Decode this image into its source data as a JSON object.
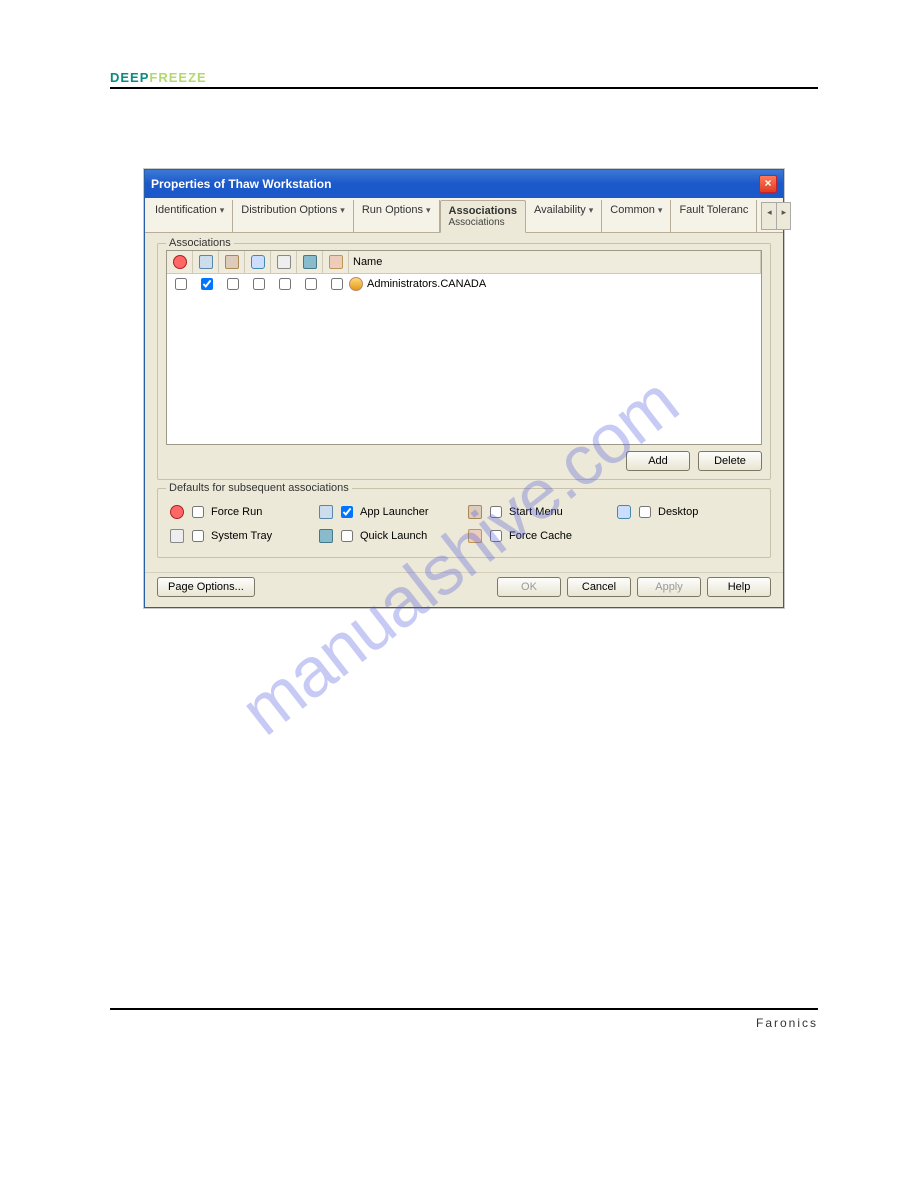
{
  "page": {
    "logo_part1": "DEEP",
    "logo_part2": "FREEZE",
    "watermark": "manualshive.com",
    "footer_brand": "Faronics"
  },
  "dialog": {
    "title": "Properties of Thaw Workstation",
    "tabs": [
      {
        "label": "Identification"
      },
      {
        "label": "Distribution Options"
      },
      {
        "label": "Run Options"
      },
      {
        "label": "Associations",
        "sublabel": "Associations",
        "active": true
      },
      {
        "label": "Availability"
      },
      {
        "label": "Common"
      },
      {
        "label": "Fault Toleranc"
      }
    ],
    "associations": {
      "group_label": "Associations",
      "columns": {
        "name": "Name"
      },
      "rows": [
        {
          "name": "Administrators.CANADA",
          "force_run": false,
          "app_launcher": true,
          "start_menu": false,
          "desktop": false,
          "system_tray": false,
          "quick_launch": false,
          "force_cache": false
        }
      ],
      "buttons": {
        "add": "Add",
        "delete": "Delete"
      }
    },
    "defaults": {
      "group_label": "Defaults for subsequent associations",
      "items": [
        {
          "key": "force_run",
          "label": "Force Run",
          "checked": false
        },
        {
          "key": "app_launcher",
          "label": "App Launcher",
          "checked": true
        },
        {
          "key": "start_menu",
          "label": "Start Menu",
          "checked": false
        },
        {
          "key": "desktop",
          "label": "Desktop",
          "checked": false
        },
        {
          "key": "system_tray",
          "label": "System Tray",
          "checked": false
        },
        {
          "key": "quick_launch",
          "label": "Quick Launch",
          "checked": false
        },
        {
          "key": "force_cache",
          "label": "Force Cache",
          "checked": false
        }
      ]
    },
    "footer": {
      "page_options": "Page Options...",
      "ok": "OK",
      "cancel": "Cancel",
      "apply": "Apply",
      "help": "Help"
    }
  }
}
